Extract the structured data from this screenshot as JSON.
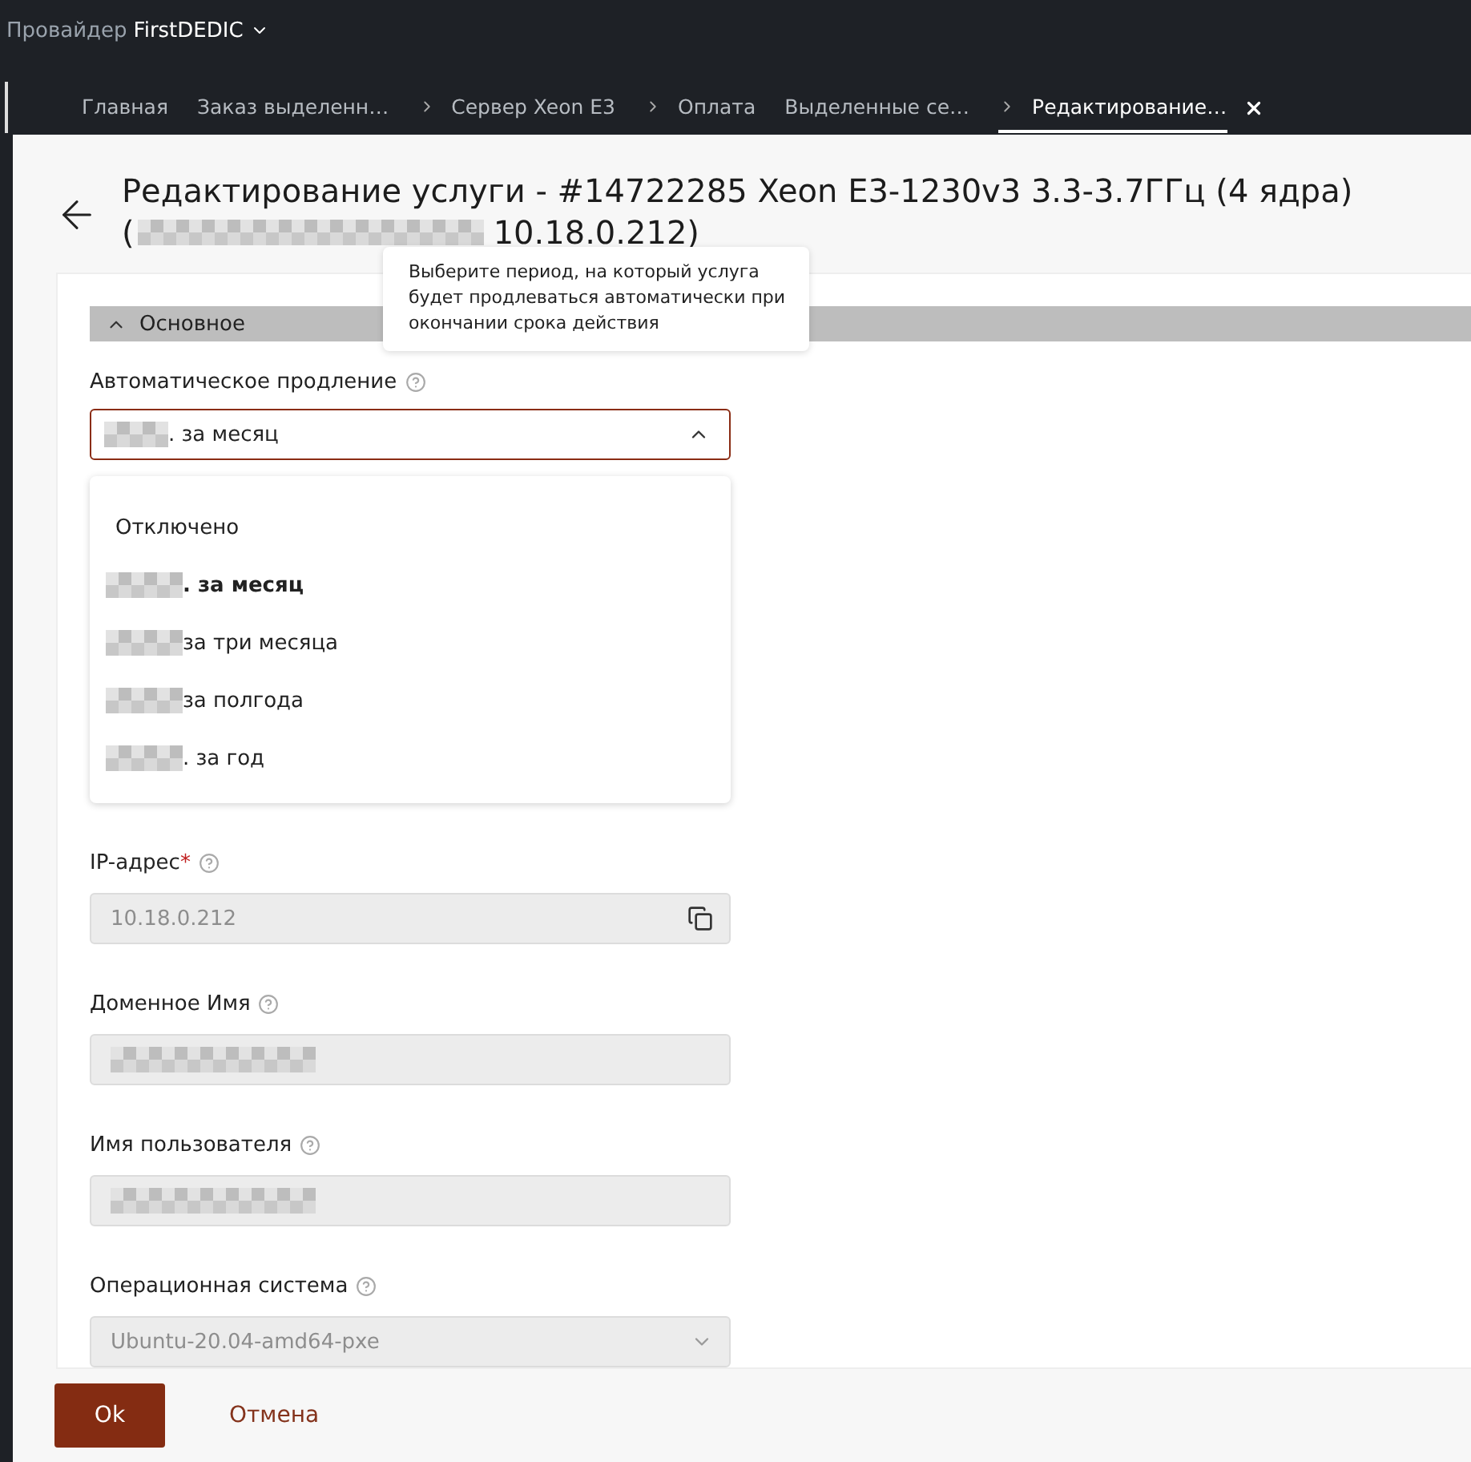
{
  "header": {
    "provider_label": "Провайдер",
    "provider_name": "FirstDEDIC"
  },
  "tabs": [
    {
      "label": "Главная",
      "nested": false,
      "selected": false
    },
    {
      "label": "Заказ выделенн…",
      "nested": false,
      "selected": false
    },
    {
      "label": "Сервер Xeon E3",
      "nested": true,
      "selected": false
    },
    {
      "label": "Оплата",
      "nested": true,
      "selected": false
    },
    {
      "label": "Выделенные се…",
      "nested": false,
      "selected": false
    },
    {
      "label": "Редактирование…",
      "nested": true,
      "selected": true
    }
  ],
  "page": {
    "title": "Редактирование услуги - #14722285 Xeon E3-1230v3 3.3-3.7ГГц (4 ядра)",
    "title_line2_open": "(",
    "title_line2_rest": "10.18.0.212)"
  },
  "tooltip": "Выберите период, на который услуга будет продлеваться автоматически при окончании срока действия",
  "section": {
    "title": "Основное",
    "expanded": true
  },
  "renewal": {
    "label": "Автоматическое продление",
    "value": ". за месяц",
    "open": true,
    "options": [
      {
        "text": "Отключено",
        "masked": false,
        "selected": false
      },
      {
        "text": ". за месяц",
        "masked": true,
        "selected": true
      },
      {
        "text": "за три месяца",
        "masked": true,
        "selected": false
      },
      {
        "text": "за полгода",
        "masked": true,
        "selected": false
      },
      {
        "text": ". за год",
        "masked": true,
        "selected": false
      }
    ]
  },
  "fields": [
    {
      "kind": "copy",
      "label": "IP-адрес",
      "required_mark": "*",
      "value": "10.18.0.212",
      "masked": false
    },
    {
      "kind": "text",
      "label": "Доменное Имя",
      "masked": true
    },
    {
      "kind": "text",
      "label": "Имя пользователя",
      "masked": true
    },
    {
      "kind": "select",
      "label": "Операционная система",
      "value": "Ubuntu-20.04-amd64-pxe",
      "masked": false
    }
  ],
  "buttons": {
    "ok": "Ok",
    "cancel": "Отмена"
  }
}
